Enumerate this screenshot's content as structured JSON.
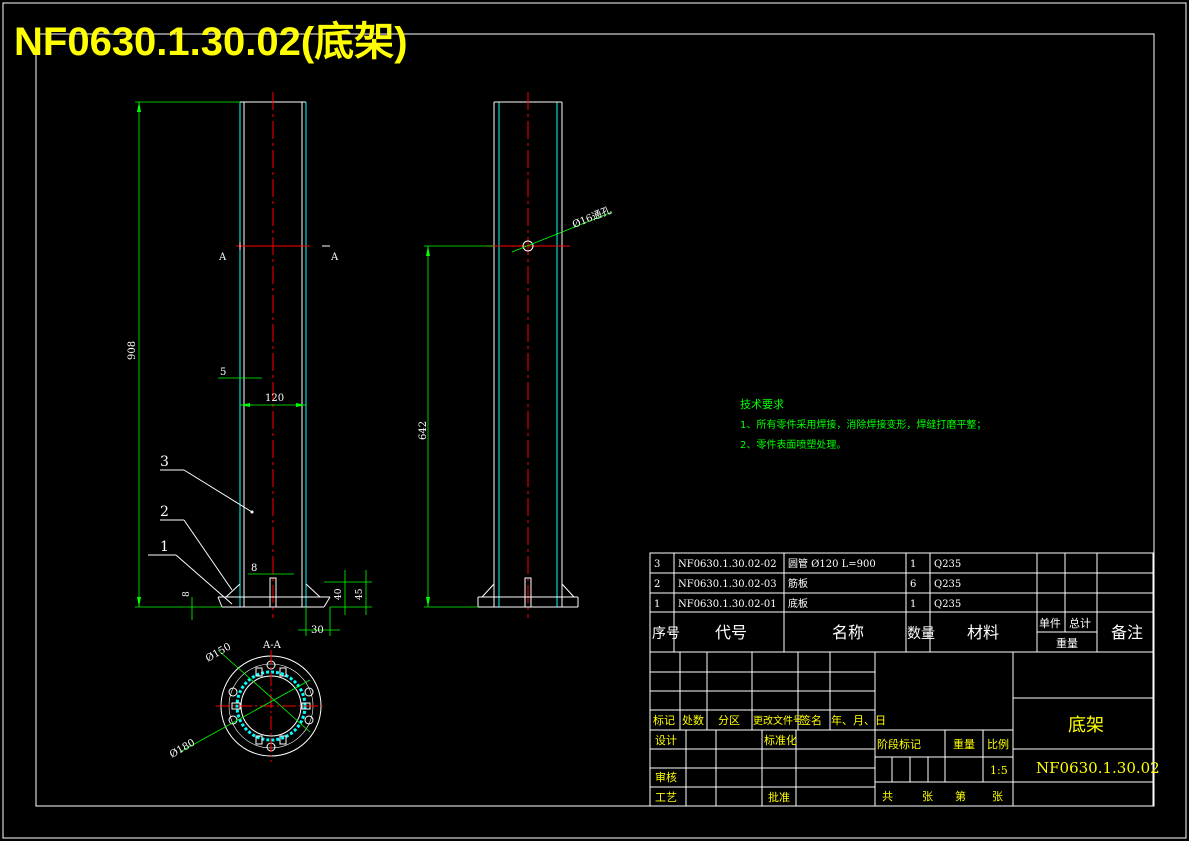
{
  "drawing": {
    "title": "NF0630.1.30.02(底架)"
  },
  "front_view": {
    "section_letter_left": "A",
    "section_letter_right": "A",
    "dim_height": "908",
    "dim_wall": "5",
    "dim_width": "120",
    "dim_slot": "8",
    "dim_foot_a": "8",
    "dim_foot_b": "40",
    "dim_foot_c": "45",
    "dim_foot_d": "30",
    "balloons": [
      "3",
      "2",
      "1"
    ]
  },
  "side_view": {
    "dim_height": "642",
    "hole_note": "Ø16通孔"
  },
  "section_view": {
    "label": "A-A",
    "dim_outer": "Ø180",
    "dim_inner": "Ø150"
  },
  "tech_requirements": {
    "heading": "技术要求",
    "line1": "1、所有零件采用焊接，消除焊接变形，焊缝打磨平整；",
    "line2": "2、零件表面喷塑处理。"
  },
  "bom": {
    "rows": [
      {
        "no": "3",
        "code": "NF0630.1.30.02-02",
        "name": "圆管 Ø120 L=900",
        "qty": "1",
        "material": "Q235"
      },
      {
        "no": "2",
        "code": "NF0630.1.30.02-03",
        "name": "筋板",
        "qty": "6",
        "material": "Q235"
      },
      {
        "no": "1",
        "code": "NF0630.1.30.02-01",
        "name": "底板",
        "qty": "1",
        "material": "Q235"
      }
    ],
    "header": {
      "no": "序号",
      "code": "代号",
      "name": "名称",
      "qty": "数量",
      "material": "材料",
      "unit": "单件",
      "total": "总计",
      "weight": "重量",
      "remark": "备注"
    }
  },
  "title_block": {
    "mark": "标记",
    "count": "处数",
    "zone": "分区",
    "doc": "更改文件号",
    "sign": "签名",
    "date": "年、月、日",
    "design": "设计",
    "standard": "标准化",
    "review": "审核",
    "process": "工艺",
    "approve": "批准",
    "stage": "阶段标记",
    "weight": "重量",
    "scale": "比例",
    "scale_value": "1:5",
    "total_sheets": "共",
    "sheets": "张",
    "sheet_no": "第",
    "sheet": "张",
    "part_name": "底架",
    "part_code": "NF0630.1.30.02"
  }
}
